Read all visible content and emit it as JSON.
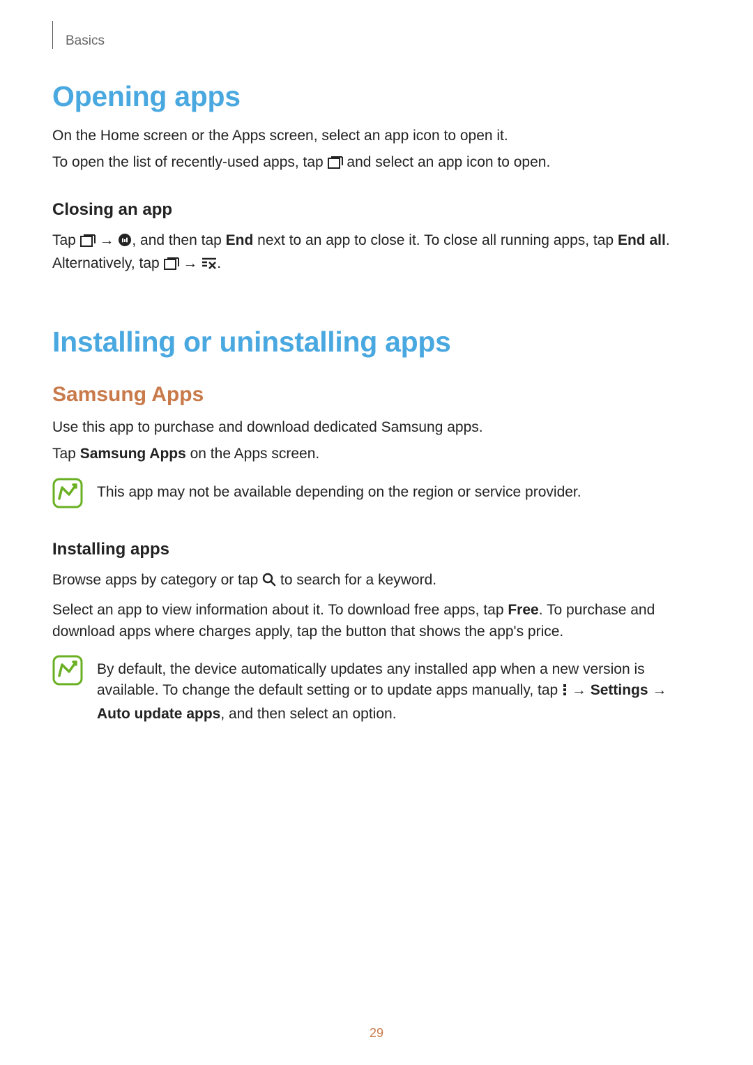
{
  "header": {
    "section": "Basics"
  },
  "s1": {
    "title": "Opening apps",
    "p1a": "On the Home screen or the Apps screen, select an app icon to open it.",
    "p2a": "To open the list of recently-used apps, tap ",
    "p2b": " and select an app icon to open.",
    "sub1": "Closing an app",
    "p3a": "Tap ",
    "p3b": " → ",
    "p3c": ", and then tap ",
    "p3_end": "End",
    "p3d": " next to an app to close it. To close all running apps, tap ",
    "p3_endall": "End all",
    "p3e": ". Alternatively, tap ",
    "p3f": " → ",
    "p3g": "."
  },
  "s2": {
    "title": "Installing or uninstalling apps",
    "sub1": "Samsung Apps",
    "p1": "Use this app to purchase and download dedicated Samsung apps.",
    "p2a": "Tap ",
    "p2_bold": "Samsung Apps",
    "p2b": " on the Apps screen.",
    "note1": "This app may not be available depending on the region or service provider.",
    "sub2": "Installing apps",
    "p3a": "Browse apps by category or tap ",
    "p3b": " to search for a keyword.",
    "p4a": "Select an app to view information about it. To download free apps, tap ",
    "p4_free": "Free",
    "p4b": ". To purchase and download apps where charges apply, tap the button that shows the app's price.",
    "note2a": "By default, the device automatically updates any installed app when a new version is available. To change the default setting or to update apps manually, tap ",
    "note2b": " → ",
    "note2_settings": "Settings",
    "note2c": " → ",
    "note2_auto": "Auto update apps",
    "note2d": ", and then select an option."
  },
  "page_number": "29"
}
